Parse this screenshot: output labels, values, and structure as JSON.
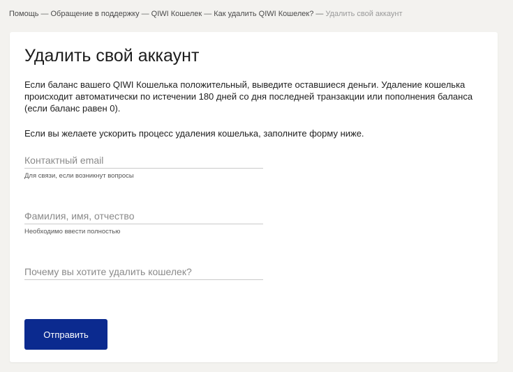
{
  "breadcrumb": {
    "items": [
      "Помощь",
      "Обращение в поддержку",
      "QIWI Кошелек",
      "Как удалить QIWI Кошелек?"
    ],
    "separator": "—",
    "current": "Удалить свой аккаунт"
  },
  "page": {
    "title": "Удалить свой аккаунт",
    "paragraph1": "Если баланс вашего QIWI Кошелька положительный, выведите оставшиеся деньги. Удаление кошелька происходит автоматически по истечении 180 дней со дня последней транзакции или пополнения баланса (если баланс равен 0).",
    "paragraph2": "Если вы желаете ускорить процесс удаления кошелька, заполните форму ниже."
  },
  "form": {
    "email": {
      "placeholder": "Контактный email",
      "value": "",
      "hint": "Для связи, если возникнут вопросы"
    },
    "name": {
      "placeholder": "Фамилия, имя, отчество",
      "value": "",
      "hint": "Необходимо ввести полностью"
    },
    "reason": {
      "placeholder": "Почему вы хотите удалить кошелек?",
      "value": ""
    },
    "submit_label": "Отправить"
  },
  "colors": {
    "background": "#f3f2ef",
    "card": "#ffffff",
    "button": "#0b2a8f"
  }
}
